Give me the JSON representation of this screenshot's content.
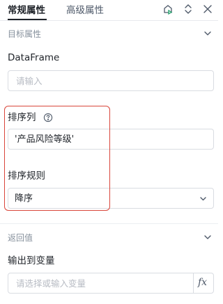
{
  "tabs": {
    "general": "常规属性",
    "advanced": "高级属性"
  },
  "toolbar": {
    "icons": [
      "run-icon",
      "expand-collapse-icon",
      "close-icon"
    ]
  },
  "target_section": {
    "title": "目标属性"
  },
  "dataframe": {
    "label": "DataFrame",
    "placeholder": "请输入"
  },
  "sort_column": {
    "label": "排序列",
    "value": "'产品风险等级'"
  },
  "sort_rule": {
    "label": "排序规则",
    "value": "降序"
  },
  "return_section": {
    "title": "返回值"
  },
  "output_var": {
    "label": "输出到变量",
    "placeholder": "请选择或输入变量",
    "fx": "fx"
  },
  "colors": {
    "highlight": "#d9453a",
    "border": "#d9dce1",
    "muted": "#86909c"
  }
}
